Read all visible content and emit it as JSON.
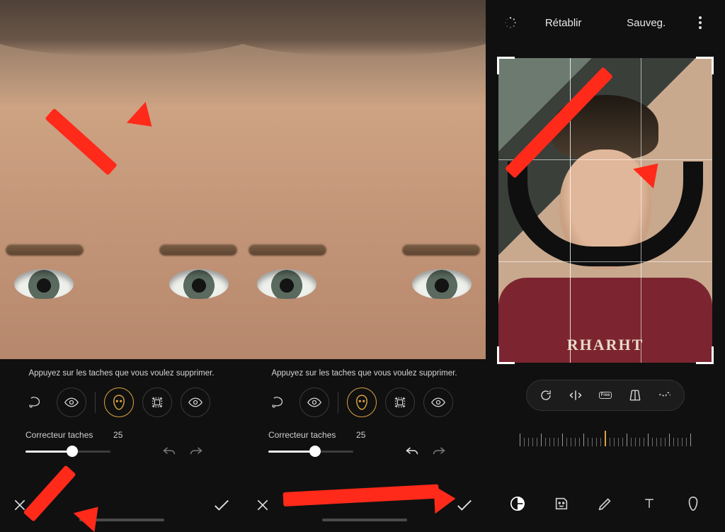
{
  "left": {
    "hint": "Appuyez sur les taches que vous voulez supprimer.",
    "slider_label": "Correcteur taches",
    "slider_value": "25",
    "slider_percent": 55
  },
  "mid": {
    "hint": "Appuyez sur les taches que vous voulez supprimer.",
    "slider_label": "Correcteur taches",
    "slider_value": "25",
    "slider_percent": 55
  },
  "right": {
    "reset_label": "Rétablir",
    "save_label": "Sauveg.",
    "free_label": "Free",
    "shirt_text": "RHARHT"
  },
  "icons": {
    "lasso": "lasso-icon",
    "eye": "eye-icon",
    "face": "face-icon",
    "pattern": "pattern-icon",
    "undo": "undo-icon",
    "redo": "redo-icon",
    "cancel": "cancel-icon",
    "confirm": "confirm-icon",
    "spinner": "spinner-icon",
    "more": "more-vertical-icon",
    "rotate": "rotate-icon",
    "flip": "flip-horizontal-icon",
    "perspective": "perspective-icon",
    "freeform": "freeform-icon",
    "adjust": "adjust-icon",
    "sticker": "sticker-icon",
    "draw": "draw-icon",
    "text": "text-icon",
    "portrait": "portrait-icon"
  }
}
